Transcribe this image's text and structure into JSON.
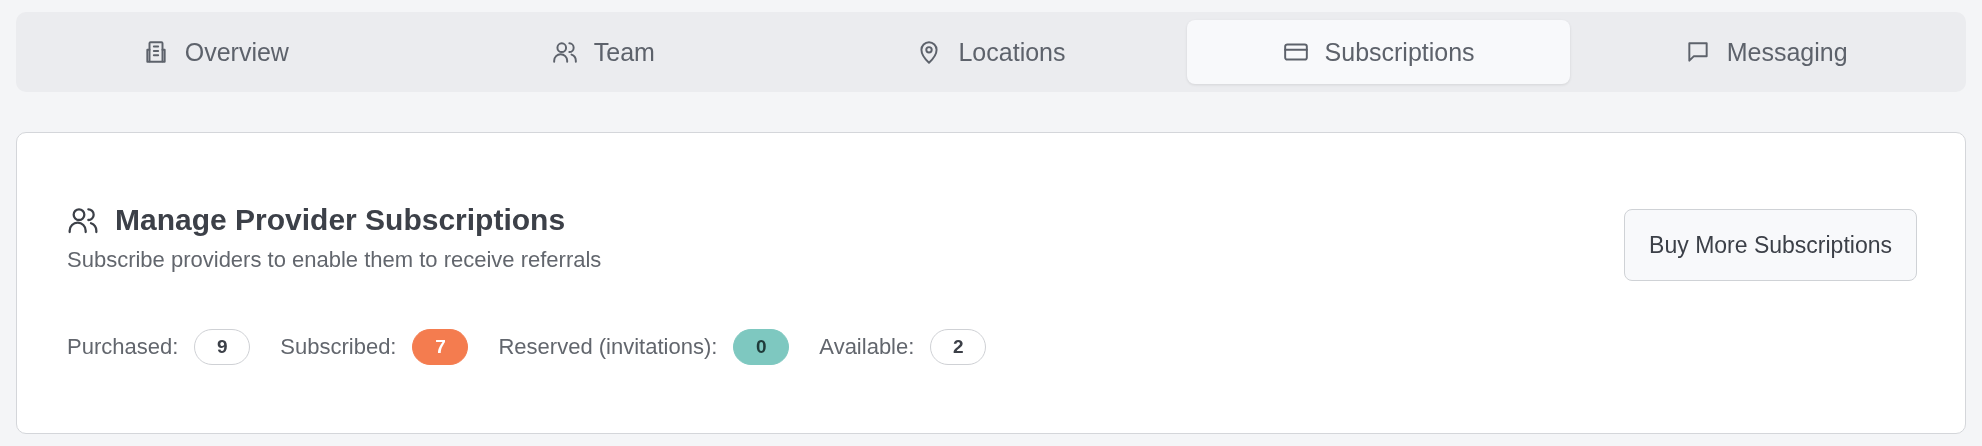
{
  "tabs": [
    {
      "label": "Overview",
      "selected": false
    },
    {
      "label": "Team",
      "selected": false
    },
    {
      "label": "Locations",
      "selected": false
    },
    {
      "label": "Subscriptions",
      "selected": true
    },
    {
      "label": "Messaging",
      "selected": false
    }
  ],
  "card": {
    "title": "Manage Provider Subscriptions",
    "subtitle": "Subscribe providers to enable them to receive referrals",
    "button": "Buy More Subscriptions",
    "stats": [
      {
        "label": "Purchased:",
        "value": "9",
        "color": "#ffffff"
      },
      {
        "label": "Subscribed:",
        "value": "7",
        "color": "#f47c4f"
      },
      {
        "label": "Reserved (invitations):",
        "value": "0",
        "color": "#7ec8c0"
      },
      {
        "label": "Available:",
        "value": "2",
        "color": "#ffffff"
      }
    ]
  }
}
